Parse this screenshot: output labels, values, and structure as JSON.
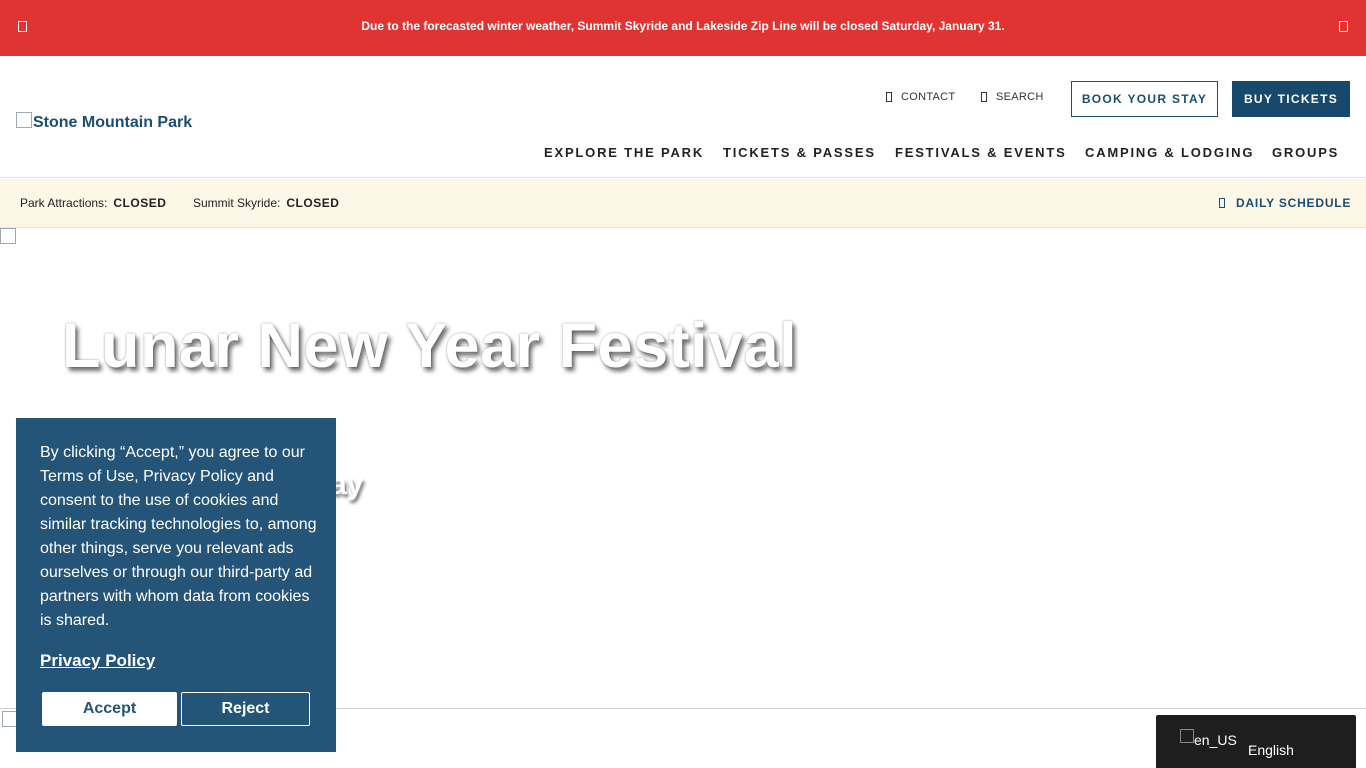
{
  "alert": {
    "message": "Due to the forecasted winter weather, Summit Skyride and Lakeside Zip Line will be closed Saturday, January 31."
  },
  "header": {
    "logo_alt": "Stone Mountain Park",
    "utility": {
      "contact_label": "CONTACT",
      "search_label": "SEARCH",
      "book_label": "BOOK YOUR STAY",
      "tickets_label": "BUY TICKETS"
    },
    "nav": [
      {
        "label": "EXPLORE THE PARK"
      },
      {
        "label": "TICKETS & PASSES"
      },
      {
        "label": "FESTIVALS & EVENTS"
      },
      {
        "label": "CAMPING & LODGING"
      },
      {
        "label": "GROUPS"
      }
    ]
  },
  "status": {
    "items": [
      {
        "label": "Park Attractions:",
        "value": "CLOSED"
      },
      {
        "label": "Summit Skyride:",
        "value": "CLOSED"
      }
    ],
    "schedule_label": "DAILY SCHEDULE"
  },
  "hero": {
    "title": "Lunar New Year Festival",
    "subtitle_visible": "ay"
  },
  "cookie": {
    "text": "By clicking “Accept,” you agree to our Terms of Use, Privacy Policy and consent to the use of cookies and similar tracking technologies to, among other things, serve you relevant ads ourselves or through our third-party ad partners with whom data from cookies is shared.",
    "policy_link": "Privacy Policy",
    "accept_label": "Accept",
    "reject_label": "Reject"
  },
  "language": {
    "flag_alt": "en_US",
    "label": "English"
  },
  "colors": {
    "alert_bg": "#e03432",
    "brand_navy": "#17496c",
    "cookie_bg": "#245478",
    "status_bg": "#fdf7e8",
    "lang_bg": "#1e1e1e"
  },
  "icons": {
    "alert_left": "alert-icon",
    "alert_close": "close-icon",
    "contact": "phone-icon",
    "search": "search-icon",
    "schedule": "calendar-icon"
  }
}
